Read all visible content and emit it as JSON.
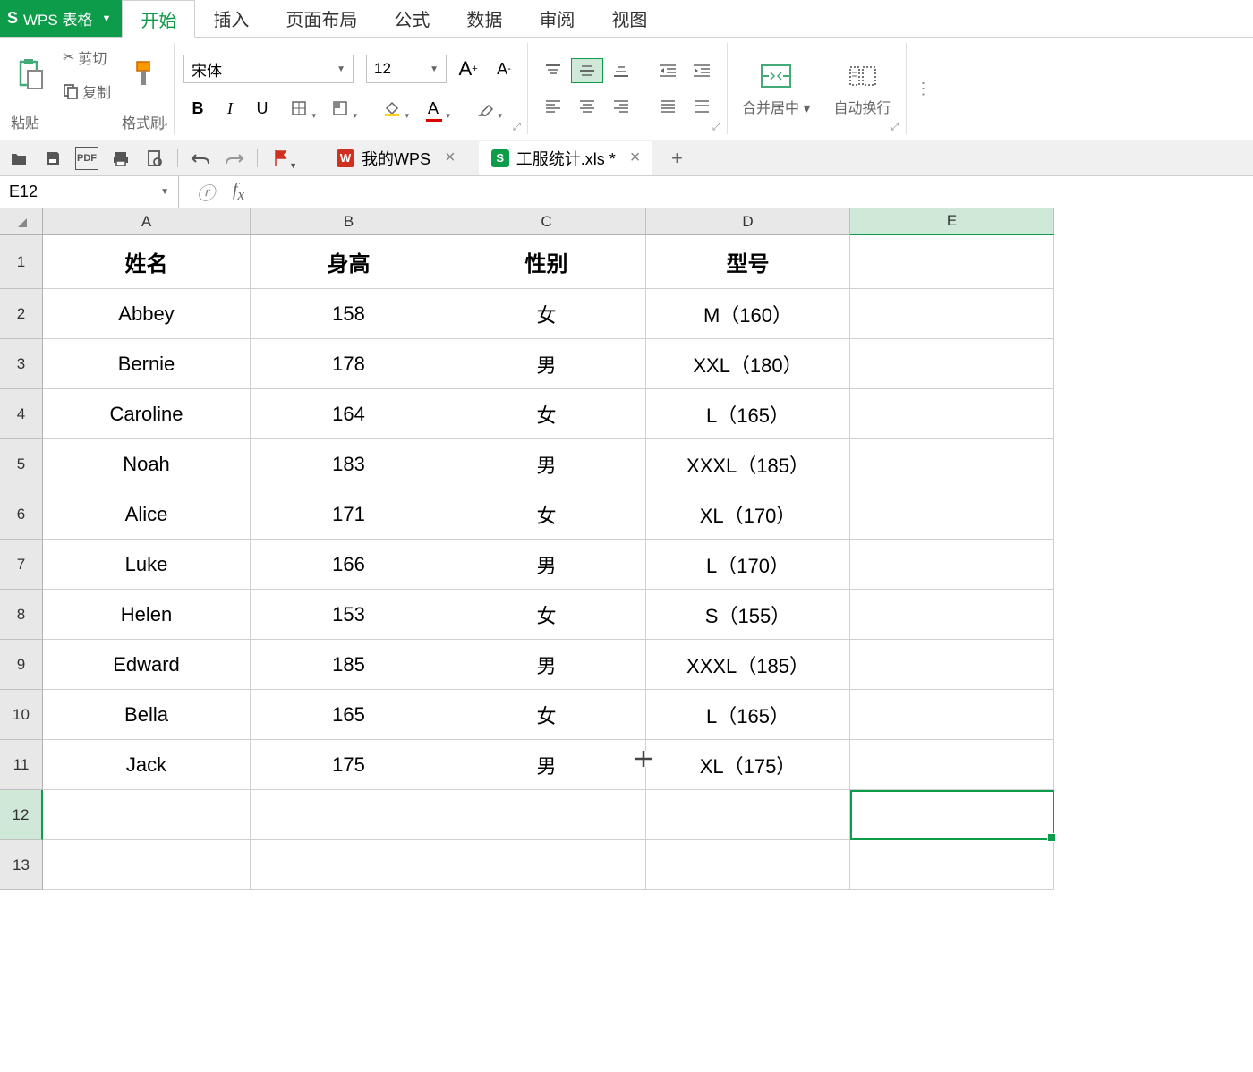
{
  "app": {
    "name": "WPS 表格"
  },
  "menu": {
    "tabs": [
      "开始",
      "插入",
      "页面布局",
      "公式",
      "数据",
      "审阅",
      "视图"
    ],
    "active": 0
  },
  "ribbon": {
    "paste": "粘贴",
    "cut": "剪切",
    "copy": "复制",
    "format_painter": "格式刷",
    "font_name": "宋体",
    "font_size": "12",
    "merge_center": "合并居中",
    "wrap_text": "自动换行"
  },
  "tabs": {
    "items": [
      {
        "label": "我的WPS",
        "icon": "W",
        "color": "red"
      },
      {
        "label": "工服统计.xls *",
        "icon": "S",
        "color": "green"
      }
    ],
    "active": 1
  },
  "name_box": "E12",
  "columns": [
    "A",
    "B",
    "C",
    "D",
    "E"
  ],
  "table": {
    "headers": [
      "姓名",
      "身高",
      "性别",
      "型号"
    ],
    "rows": [
      [
        "Abbey",
        "158",
        "女",
        "M（160）"
      ],
      [
        "Bernie",
        "178",
        "男",
        "XXL（180）"
      ],
      [
        "Caroline",
        "164",
        "女",
        "L（165）"
      ],
      [
        "Noah",
        "183",
        "男",
        "XXXL（185）"
      ],
      [
        "Alice",
        "171",
        "女",
        "XL（170）"
      ],
      [
        "Luke",
        "166",
        "男",
        "L（170）"
      ],
      [
        "Helen",
        "153",
        "女",
        "S（155）"
      ],
      [
        "Edward",
        "185",
        "男",
        "XXXL（185）"
      ],
      [
        "Bella",
        "165",
        "女",
        "L（165）"
      ],
      [
        "Jack",
        "175",
        "男",
        "XL（175）"
      ]
    ]
  },
  "selected_cell": {
    "row": 12,
    "col": "E"
  }
}
